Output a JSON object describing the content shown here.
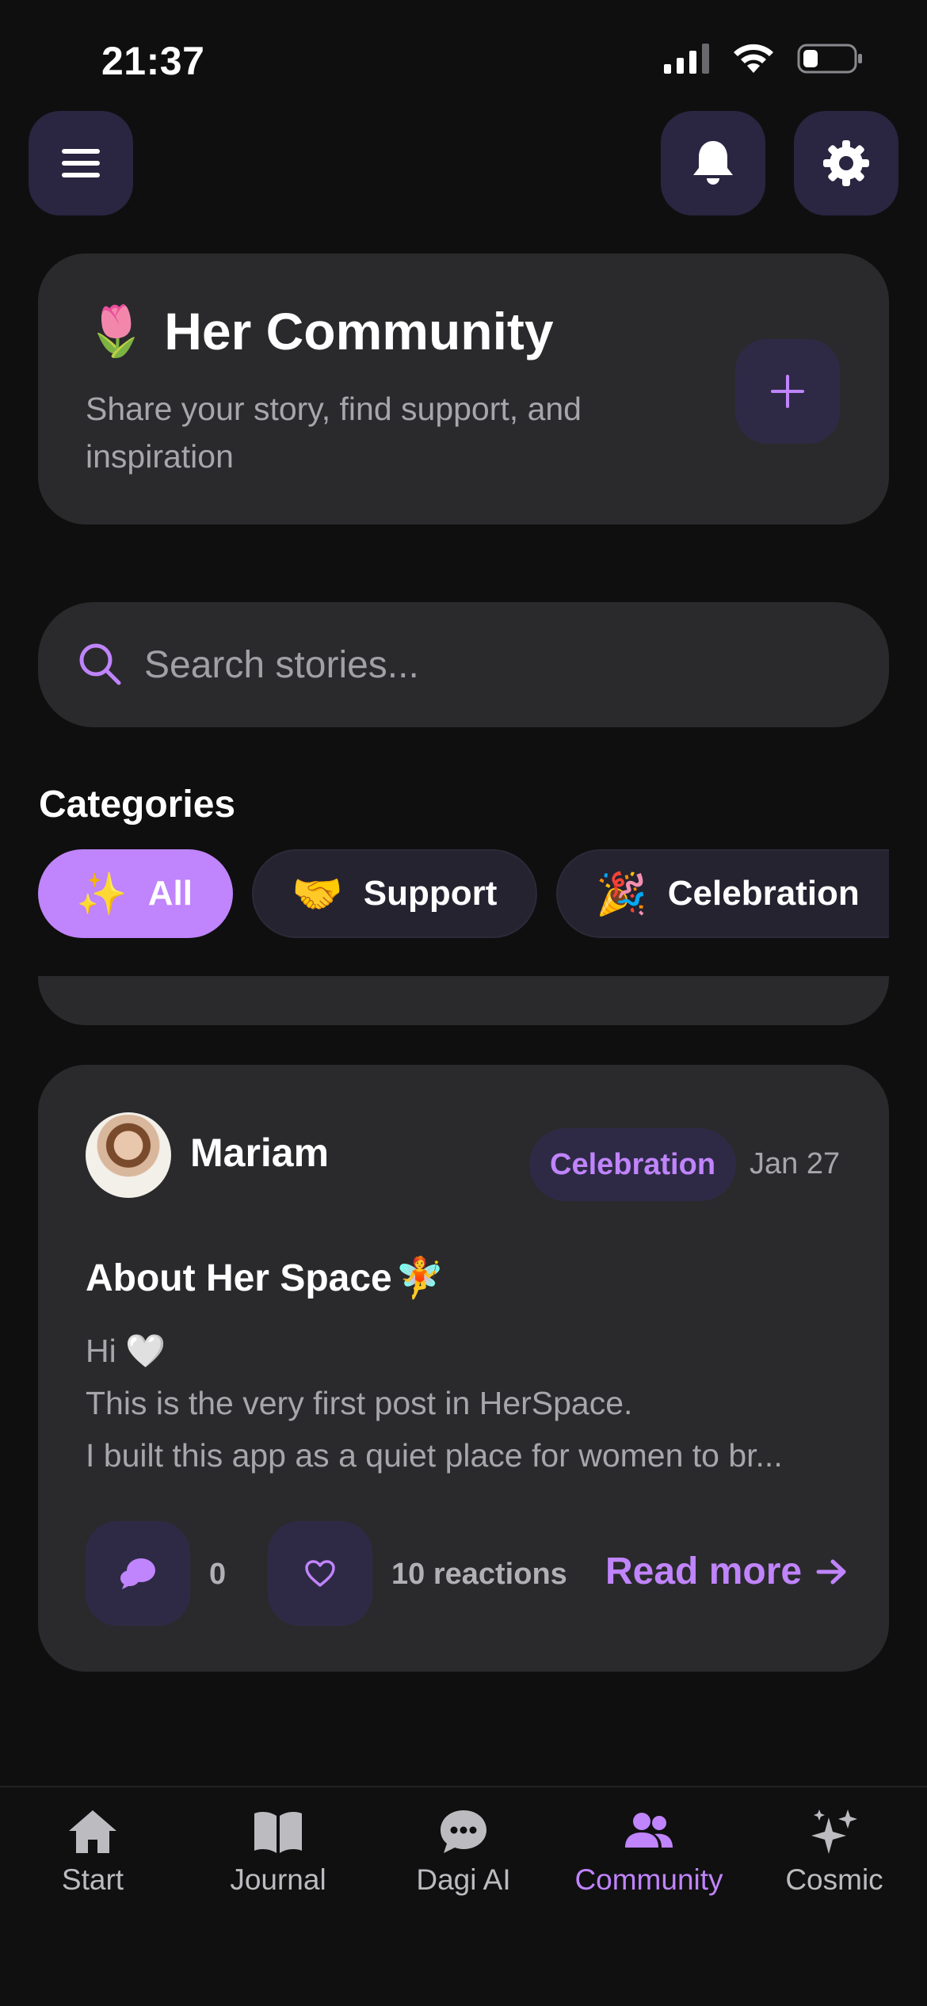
{
  "status_bar": {
    "time": "21:37"
  },
  "header": {
    "title": "Her Community",
    "title_emoji": "🌷",
    "subtitle": "Share your story, find support, and inspiration"
  },
  "search": {
    "placeholder": "Search stories..."
  },
  "categories": {
    "title": "Categories",
    "chips": [
      {
        "emoji": "✨",
        "label": "All"
      },
      {
        "emoji": "🤝",
        "label": "Support"
      },
      {
        "emoji": "🎉",
        "label": "Celebration"
      }
    ]
  },
  "post": {
    "author": "Mariam",
    "category": "Celebration",
    "date": "Jan 27",
    "title": "About Her Space",
    "title_emoji": "🧚",
    "body_lines": [
      "Hi 🤍",
      "This is the very first post in HerSpace.",
      "I built this app as a quiet place for women to br..."
    ],
    "comments_count": "0",
    "reactions_text": "10 reactions",
    "read_more": "Read more"
  },
  "tabs": [
    {
      "label": "Start",
      "icon": "home-icon"
    },
    {
      "label": "Journal",
      "icon": "book-icon"
    },
    {
      "label": "Dagi AI",
      "icon": "chat-bubble-icon"
    },
    {
      "label": "Community",
      "icon": "people-icon",
      "active": true
    },
    {
      "label": "Cosmic",
      "icon": "sparkles-icon"
    }
  ],
  "colors": {
    "background": "#0f0f10",
    "card": "#2a2a2c",
    "accent": "#c084fc",
    "button_bg": "#2a2540"
  }
}
